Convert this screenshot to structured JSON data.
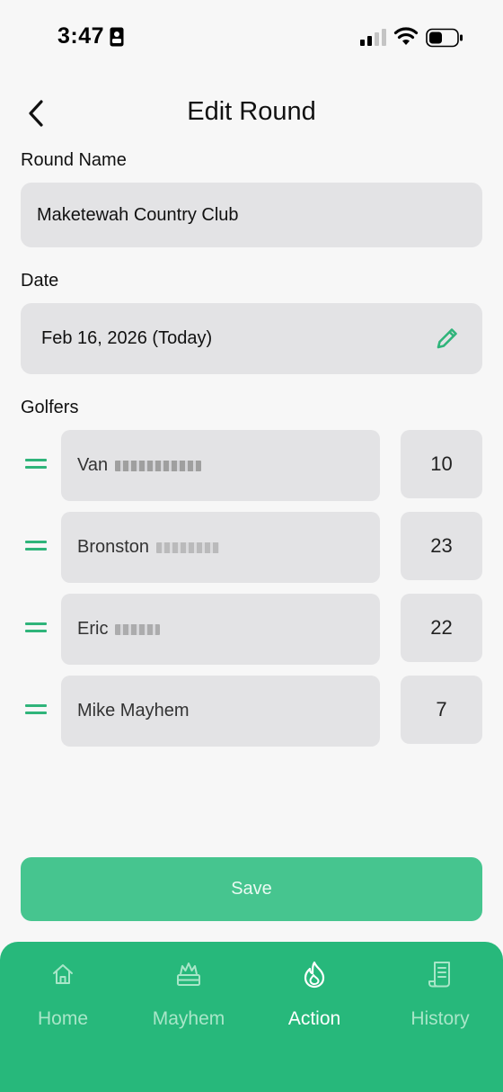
{
  "status_bar": {
    "time": "3:47"
  },
  "header": {
    "title": "Edit Round"
  },
  "round_name": {
    "label": "Round Name",
    "value": "Maketewah Country Club"
  },
  "date": {
    "label": "Date",
    "value": "Feb 16, 2026 (Today)"
  },
  "golfers": {
    "label": "Golfers",
    "items": [
      {
        "name": "Van",
        "handicap": "10"
      },
      {
        "name": "Bronston",
        "handicap": "23"
      },
      {
        "name": "Eric",
        "handicap": "22"
      },
      {
        "name": "Mike Mayhem",
        "handicap": "7"
      }
    ]
  },
  "save_label": "Save",
  "tabs": [
    {
      "label": "Home",
      "icon": "home-icon"
    },
    {
      "label": "Mayhem",
      "icon": "mayhem-icon"
    },
    {
      "label": "Action",
      "icon": "flame-icon"
    },
    {
      "label": "History",
      "icon": "scroll-icon"
    }
  ],
  "colors": {
    "accent": "#2fb47a",
    "tab_bar": "#27b87b",
    "save_button": "#46c58f",
    "field_bg": "#e3e3e5"
  }
}
